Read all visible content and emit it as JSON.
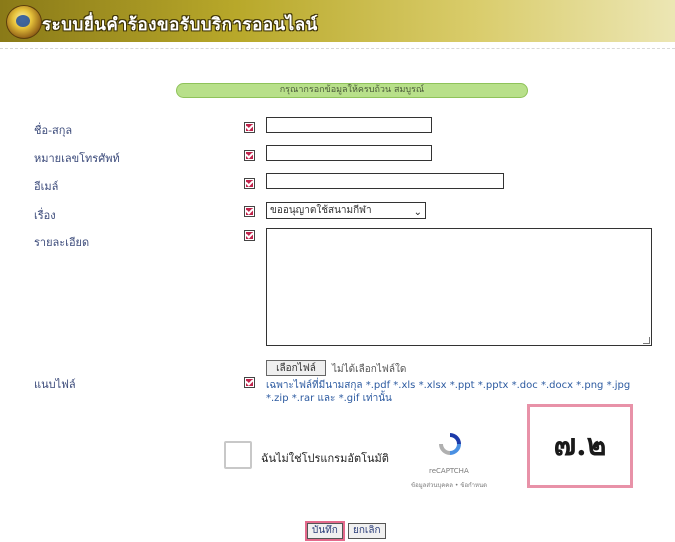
{
  "header": {
    "title": "ระบบยื่นคำร้องขอรับบริการออนไลน์"
  },
  "form": {
    "banner": "กรุณากรอกข้อมูลให้ครบถ้วน สมบูรณ์",
    "fields": {
      "name_label": "ชื่อ-สกุล",
      "phone_label": "หมายเลขโทรศัพท์",
      "email_label": "อีเมล์",
      "subject_label": "เรื่อง",
      "subject_value": "ขออนุญาตใช้สนามกีฬา",
      "detail_label": "รายละเอียด",
      "attach_label": "แนบไฟล์"
    },
    "file": {
      "button_label": "เลือกไฟล์",
      "status": "ไม่ได้เลือกไฟล์ใด",
      "help": "เฉพาะไฟล์ที่มีนามสกุล *.pdf *.xls *.xlsx *.ppt *.pptx *.doc *.docx *.png *.jpg *.zip *.rar และ *.gif เท่านั้น"
    },
    "captcha": {
      "label": "ฉันไม่ใช่โปรแกรมอัตโนมัติ",
      "brand": "reCAPTCHA",
      "links": "ข้อมูลส่วนบุคคล • ข้อกำหนด"
    },
    "buttons": {
      "save": "บันทึก",
      "cancel": "ยกเลิก"
    }
  },
  "annotation": {
    "text": "๗.๒"
  }
}
